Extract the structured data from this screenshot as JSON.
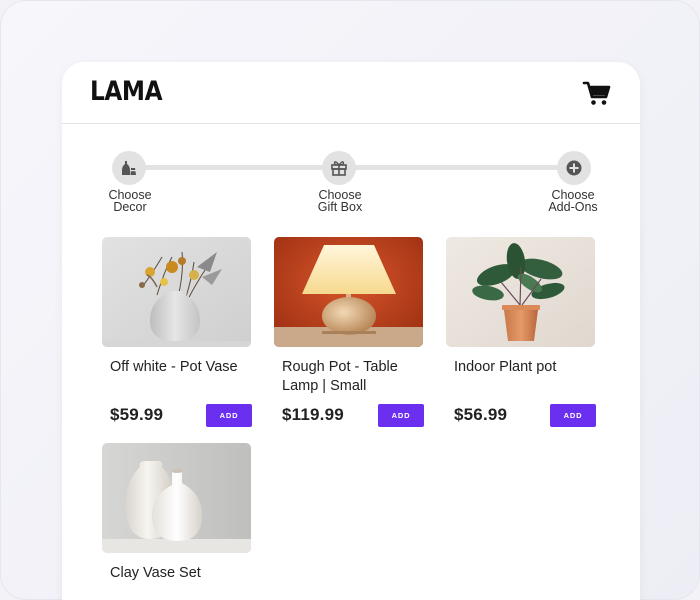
{
  "brand": {
    "logo": "LAMA"
  },
  "header": {
    "cart_icon": "shopping-cart-icon"
  },
  "steps": [
    {
      "line1": "Choose",
      "line2": "Decor",
      "icon": "vases-icon"
    },
    {
      "line1": "Choose",
      "line2": "Gift Box",
      "icon": "gift-icon"
    },
    {
      "line1": "Choose",
      "line2": "Add-Ons",
      "icon": "plus-circle-icon"
    }
  ],
  "products": [
    {
      "name": "Off white - Pot Vase",
      "price": "$59.99",
      "add_label": "ADD"
    },
    {
      "name": "Rough Pot - Table Lamp | Small",
      "price": "$119.99",
      "add_label": "ADD"
    },
    {
      "name": "Indoor Plant pot",
      "price": "$56.99",
      "add_label": "ADD"
    },
    {
      "name": "Clay Vase Set"
    }
  ],
  "colors": {
    "accent": "#6b2ff0",
    "step_circle": "#e2e2e2",
    "track": "#e3e3e3"
  }
}
